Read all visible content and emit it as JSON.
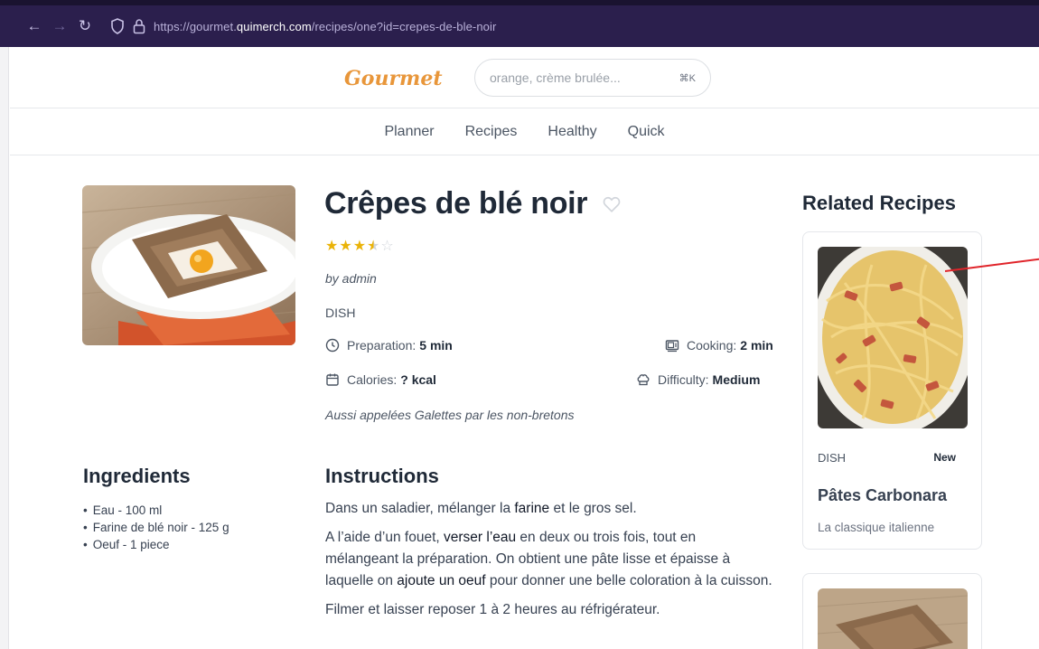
{
  "browser": {
    "url_prefix": "https://gourmet.",
    "url_domain": "quimerch.com",
    "url_path": "/recipes/one?id=crepes-de-ble-noir"
  },
  "header": {
    "logo": "Gourmet",
    "search_placeholder": "orange, crème brulée...",
    "search_shortcut": "⌘K"
  },
  "nav": {
    "items": [
      "Planner",
      "Recipes",
      "Healthy",
      "Quick"
    ]
  },
  "recipe": {
    "title": "Crêpes de blé noir",
    "rating": 3.5,
    "rating_max": 5,
    "author": "by admin",
    "category": "DISH",
    "preparation_label": "Preparation:",
    "preparation_value": "5 min",
    "cooking_label": "Cooking:",
    "cooking_value": "2 min",
    "calories_label": "Calories:",
    "calories_value": "? kcal",
    "difficulty_label": "Difficulty:",
    "difficulty_value": "Medium",
    "description": "Aussi appelées Galettes par les non-bretons"
  },
  "ingredients": {
    "heading": "Ingredients",
    "items": [
      "Eau - 100 ml",
      "Farine de blé noir - 125 g",
      "Oeuf - 1 piece"
    ]
  },
  "instructions": {
    "heading": "Instructions",
    "p1_a": "Dans un saladier, mélanger la ",
    "p1_k1": "farine",
    "p1_b": " et le gros sel.",
    "p2_a": "A l’aide d’un fouet, ",
    "p2_k1": "verser l’eau",
    "p2_b": " en deux ou trois fois, tout en mélangeant la préparation. On obtient une pâte lisse et épaisse à laquelle on ",
    "p2_k2": "ajoute un oeuf",
    "p2_c": " pour donner une belle coloration à la cuisson.",
    "p3": "Filmer et laisser reposer 1 à 2 heures au réfrigérateur."
  },
  "related": {
    "heading": "Related Recipes",
    "cards": [
      {
        "category": "DISH",
        "badge": "New",
        "title": "Pâtes Carbonara",
        "subtitle": "La classique italienne"
      }
    ]
  },
  "colors": {
    "browser_bar": "#2b1f4d",
    "logo": "#e8963a",
    "star": "#eab308",
    "annotation": "#e0242a"
  }
}
